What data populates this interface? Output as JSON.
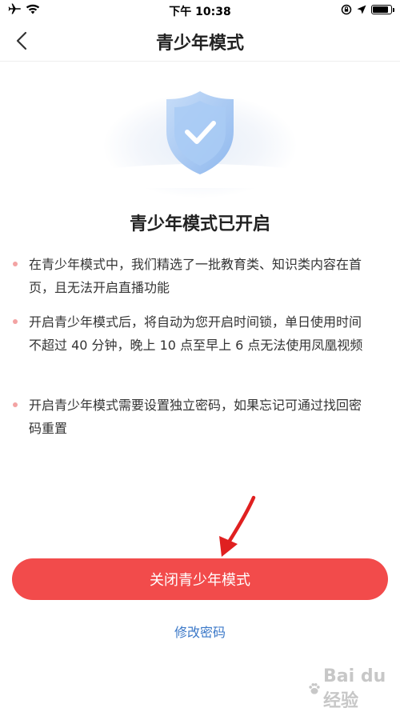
{
  "status_bar": {
    "time": "下午 10:38"
  },
  "nav": {
    "title": "青少年模式"
  },
  "hero": {
    "shield_icon": "shield-check-icon",
    "colors": {
      "shield_fill": "#a9cbf5",
      "shield_light": "#c7ddf8",
      "check": "#ffffff"
    }
  },
  "content": {
    "title": "青少年模式已开启",
    "items": [
      {
        "line1": "在青少年模式中，我们精选了一批教育类、知识类内容在首",
        "line2": "页，且无法开启直播功能"
      },
      {
        "line1": "开启青少年模式后，将自动为您开启时间锁，单日使用时间",
        "line2": "不超过 40 分钟，晚上 10 点至早上 6 点无法使用凤凰视频"
      },
      {
        "line1": "开启青少年模式需要设置独立密码，如果忘记可通过找回密",
        "line2": "码重置"
      }
    ],
    "bullet_color": "#f3a3a3"
  },
  "actions": {
    "primary_label": "关闭青少年模式",
    "secondary_label": "修改密码",
    "primary_color": "#f24b4b",
    "link_color": "#3b78c8"
  },
  "annotation": {
    "arrow_color": "#e02020"
  },
  "watermark": {
    "text": "Bai du 经验"
  }
}
